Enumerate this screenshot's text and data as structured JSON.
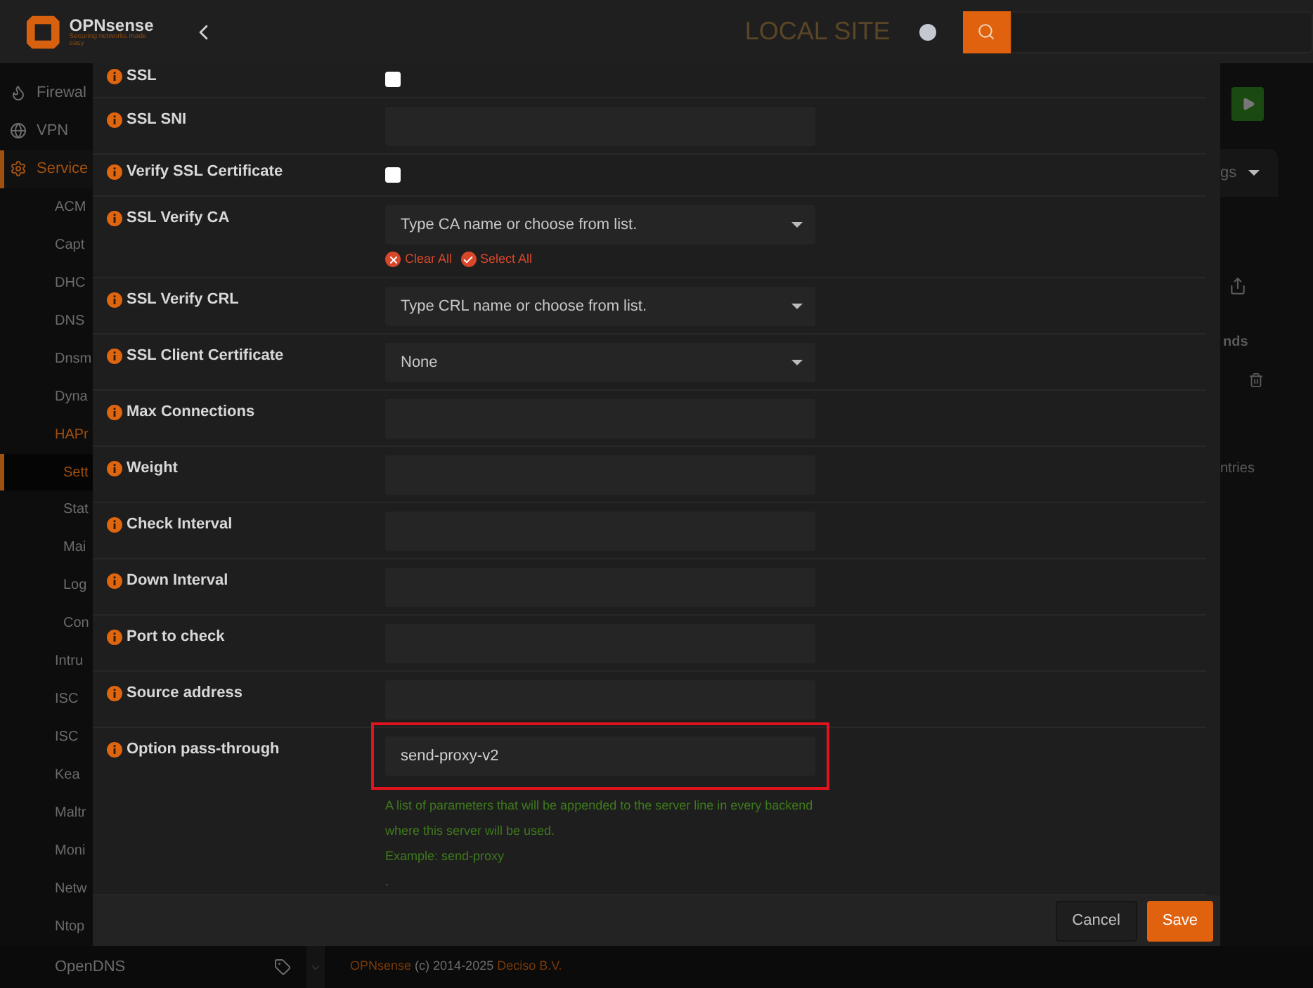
{
  "header": {
    "brand": "OPNsense",
    "tagline": "Securing networks made easy",
    "site": "LOCAL SITE"
  },
  "sidebar": {
    "items": [
      {
        "label": "Firewal",
        "selected": false
      },
      {
        "label": "VPN",
        "selected": false
      },
      {
        "label": "Service",
        "selected": true,
        "children": [
          {
            "label": "ACM",
            "selected": false
          },
          {
            "label": "Capt",
            "selected": false
          },
          {
            "label": "DHC",
            "selected": false
          },
          {
            "label": "DNS",
            "selected": false
          },
          {
            "label": "Dnsm",
            "selected": false
          },
          {
            "label": "Dyna",
            "selected": false
          },
          {
            "label": "HAPr",
            "selected": true,
            "children": [
              {
                "label": "Sett",
                "selected": true
              },
              {
                "label": "Stat",
                "selected": false
              },
              {
                "label": "Mai",
                "selected": false
              },
              {
                "label": "Log",
                "selected": false
              },
              {
                "label": "Con",
                "selected": false
              }
            ]
          },
          {
            "label": "Intru",
            "selected": false
          },
          {
            "label": "ISC",
            "selected": false
          },
          {
            "label": "ISC",
            "selected": false
          },
          {
            "label": "Kea",
            "selected": false
          },
          {
            "label": "Maltr",
            "selected": false
          },
          {
            "label": "Moni",
            "selected": false
          },
          {
            "label": "Netw",
            "selected": false
          },
          {
            "label": "Ntop",
            "selected": false
          },
          {
            "label": "OpenDNS",
            "selected": false
          }
        ]
      }
    ]
  },
  "background": {
    "tab_fragment": "gs",
    "heading_fragment": "nds",
    "entries_fragment": "ntries"
  },
  "dialog": {
    "rows": [
      {
        "label": "SSL",
        "kind": "checkbox",
        "checked": false
      },
      {
        "label": "SSL SNI",
        "kind": "text"
      },
      {
        "label": "Verify SSL Certificate",
        "kind": "checkbox",
        "checked": false
      },
      {
        "label": "SSL Verify CA",
        "kind": "select",
        "placeholder": "Type CA name or choose from list.",
        "links": [
          "Clear All",
          "Select All"
        ]
      },
      {
        "label": "SSL Verify CRL",
        "kind": "select",
        "placeholder": "Type CRL name or choose from list."
      },
      {
        "label": "SSL Client Certificate",
        "kind": "select",
        "value": "None"
      },
      {
        "label": "Max Connections",
        "kind": "text"
      },
      {
        "label": "Weight",
        "kind": "text"
      },
      {
        "label": "Check Interval",
        "kind": "text"
      },
      {
        "label": "Down Interval",
        "kind": "text"
      },
      {
        "label": "Port to check",
        "kind": "text"
      },
      {
        "label": "Source address",
        "kind": "text"
      },
      {
        "label": "Option pass-through",
        "kind": "text",
        "value": "send-proxy-v2",
        "highlighted": true,
        "help": [
          "A list of parameters that will be appended to the server line in every backend where this server will be used.",
          "Example: send-proxy",
          "."
        ]
      }
    ],
    "buttons": [
      {
        "label": "Cancel",
        "kind": "secondary"
      },
      {
        "label": "Save",
        "kind": "primary"
      }
    ]
  },
  "footer": {
    "brand": "OPNsense",
    "copyright": "(c) 2014-2025",
    "company": "Deciso B.V."
  }
}
